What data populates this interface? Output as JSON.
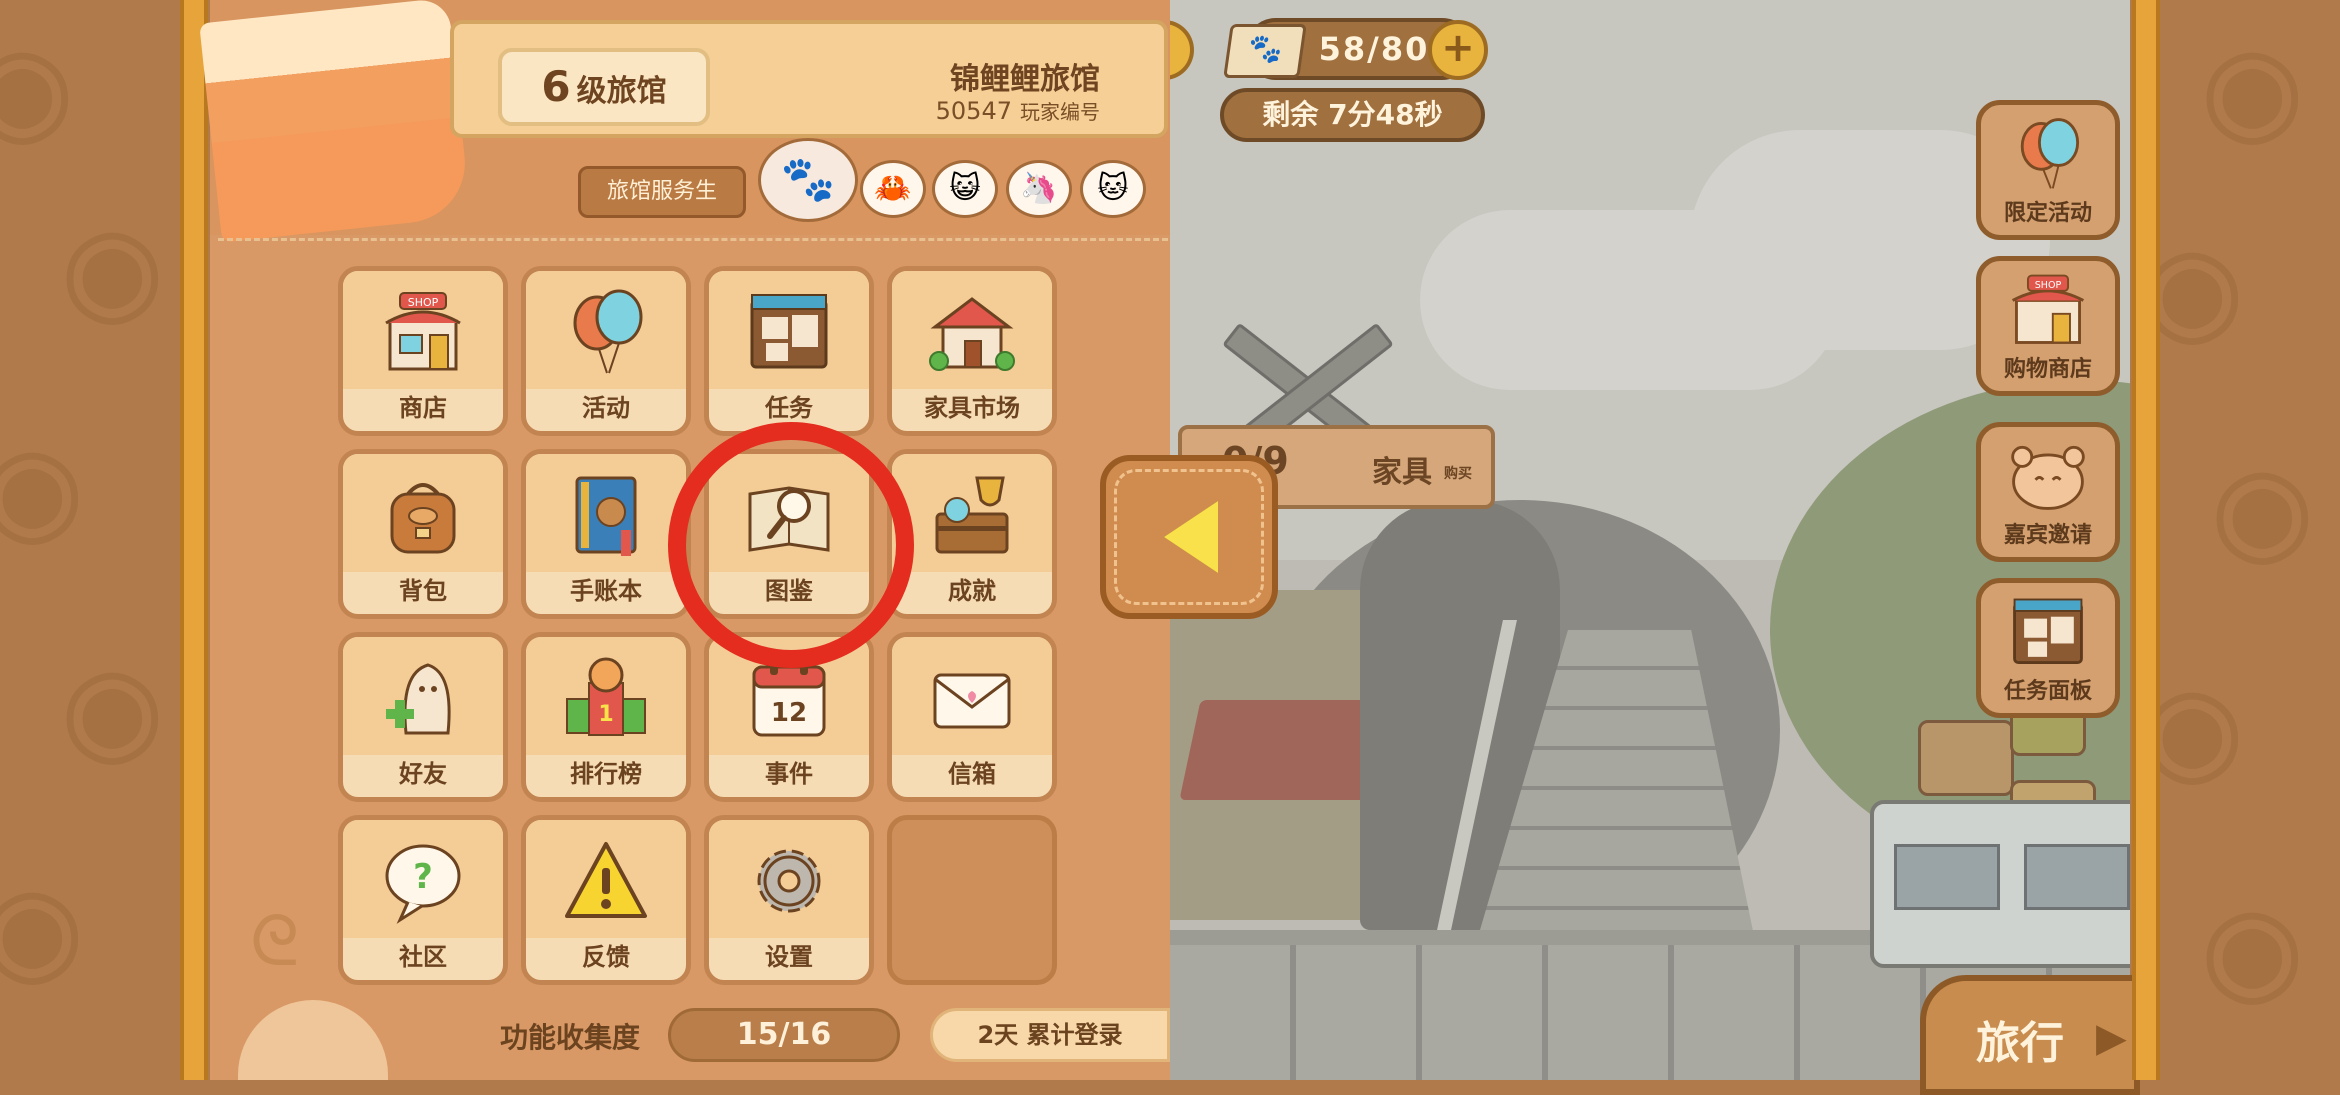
{
  "header": {
    "level_num": "6",
    "level_suffix": "级旅馆",
    "inn_name": "锦鲤鲤旅馆",
    "player_id": "50547",
    "player_id_label": "玩家编号",
    "staff_label": "旅馆服务生",
    "staff_avatars": [
      "paw-icon",
      "crab-icon",
      "cat-face-icon",
      "unicorn-cat-icon",
      "leaf-cat-icon"
    ]
  },
  "menu": {
    "items": [
      {
        "label": "商店",
        "icon": "shop-icon"
      },
      {
        "label": "活动",
        "icon": "balloons-icon"
      },
      {
        "label": "任务",
        "icon": "task-board-icon"
      },
      {
        "label": "家具市场",
        "icon": "furniture-market-icon"
      },
      {
        "label": "背包",
        "icon": "backpack-icon"
      },
      {
        "label": "手账本",
        "icon": "journal-icon"
      },
      {
        "label": "图鉴",
        "icon": "encyclopedia-icon"
      },
      {
        "label": "成就",
        "icon": "trophy-chest-icon"
      },
      {
        "label": "好友",
        "icon": "add-friend-icon"
      },
      {
        "label": "排行榜",
        "icon": "leaderboard-icon"
      },
      {
        "label": "事件",
        "icon": "calendar-icon",
        "calendar_day": "12"
      },
      {
        "label": "信箱",
        "icon": "mail-icon"
      },
      {
        "label": "社区",
        "icon": "community-icon"
      },
      {
        "label": "反馈",
        "icon": "warning-icon"
      },
      {
        "label": "设置",
        "icon": "gear-icon"
      }
    ]
  },
  "footer": {
    "collect_label": "功能收集度",
    "collect_value": "15/16",
    "login_text": "2天 累计登录"
  },
  "top_hud": {
    "paw_count": "58/80",
    "timer": "剩余  7分48秒"
  },
  "scene": {
    "furniture_count": "0/9",
    "furniture_label": "家具",
    "furniture_sub": "购买"
  },
  "right_buttons": [
    {
      "label": "限定活动",
      "icon": "balloons-icon"
    },
    {
      "label": "购物商店",
      "icon": "shop-icon"
    },
    {
      "label": "嘉宾邀请",
      "icon": "hamster-guest-icon"
    },
    {
      "label": "任务面板",
      "icon": "task-board-icon"
    }
  ],
  "travel_button": {
    "label": "旅行"
  },
  "colors": {
    "panel_bg": "#d99966",
    "tile_bg": "#f6dcb5",
    "tile_border": "#c28450",
    "highlight_ring": "#e42c1f",
    "accent_yellow": "#f8e14a"
  }
}
